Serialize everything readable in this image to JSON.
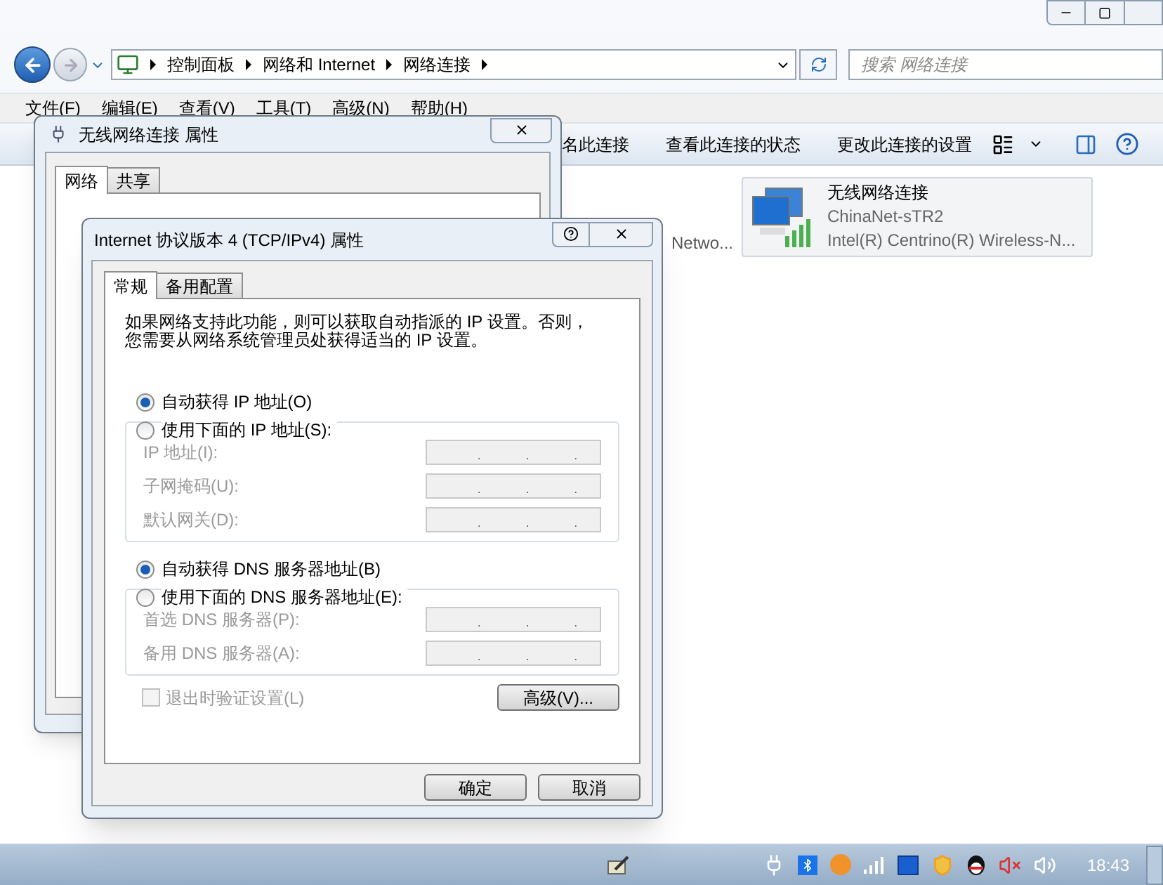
{
  "explorer": {
    "breadcrumb": [
      "控制面板",
      "网络和 Internet",
      "网络连接"
    ],
    "search": {
      "placeholder": "搜索 网络连接"
    },
    "menu": [
      "文件(F)",
      "编辑(E)",
      "查看(V)",
      "工具(T)",
      "高级(N)",
      "帮助(H)"
    ],
    "toolbar": [
      "名此连接",
      "查看此连接的状态",
      "更改此连接的设置"
    ],
    "partial_item": "Netwo...",
    "connection": {
      "name": "无线网络连接",
      "network": "ChinaNet-sTR2",
      "adapter": "Intel(R) Centrino(R) Wireless-N..."
    }
  },
  "properties_dialog": {
    "title": "无线网络连接 属性",
    "tabs": [
      {
        "label": "网络",
        "selected": true
      },
      {
        "label": "共享",
        "selected": false
      }
    ]
  },
  "ipv4_dialog": {
    "title": "Internet 协议版本 4 (TCP/IPv4) 属性",
    "tabs": [
      {
        "label": "常规",
        "selected": true
      },
      {
        "label": "备用配置",
        "selected": false
      }
    ],
    "description": "如果网络支持此功能，则可以获取自动指派的 IP 设置。否则，您需要从网络系统管理员处获得适当的 IP 设置。",
    "sections": [
      {
        "auto": {
          "label": "自动获得 IP 地址(O)",
          "selected": true
        },
        "manual": {
          "label": "使用下面的 IP 地址(S):",
          "selected": false
        },
        "fields": [
          {
            "label": "IP 地址(I):",
            "disabled": true,
            "separators": [
              ".",
              ".",
              "."
            ]
          },
          {
            "label": "子网掩码(U):",
            "disabled": true,
            "separators": [
              ".",
              ".",
              "."
            ]
          },
          {
            "label": "默认网关(D):",
            "disabled": true,
            "separators": [
              ".",
              ".",
              "."
            ]
          }
        ]
      },
      {
        "auto": {
          "label": "自动获得 DNS 服务器地址(B)",
          "selected": true
        },
        "manual": {
          "label": "使用下面的 DNS 服务器地址(E):",
          "selected": false
        },
        "fields": [
          {
            "label": "首选 DNS 服务器(P):",
            "disabled": true,
            "separators": [
              ".",
              ".",
              "."
            ]
          },
          {
            "label": "备用 DNS 服务器(A):",
            "disabled": true,
            "separators": [
              ".",
              ".",
              "."
            ]
          }
        ]
      }
    ],
    "validate": {
      "label": "退出时验证设置(L)",
      "checked": false,
      "disabled": true
    },
    "advanced_button": "高级(V)...",
    "buttons": [
      "确定",
      "取消"
    ]
  },
  "taskbar": {
    "clock": "18:43"
  }
}
